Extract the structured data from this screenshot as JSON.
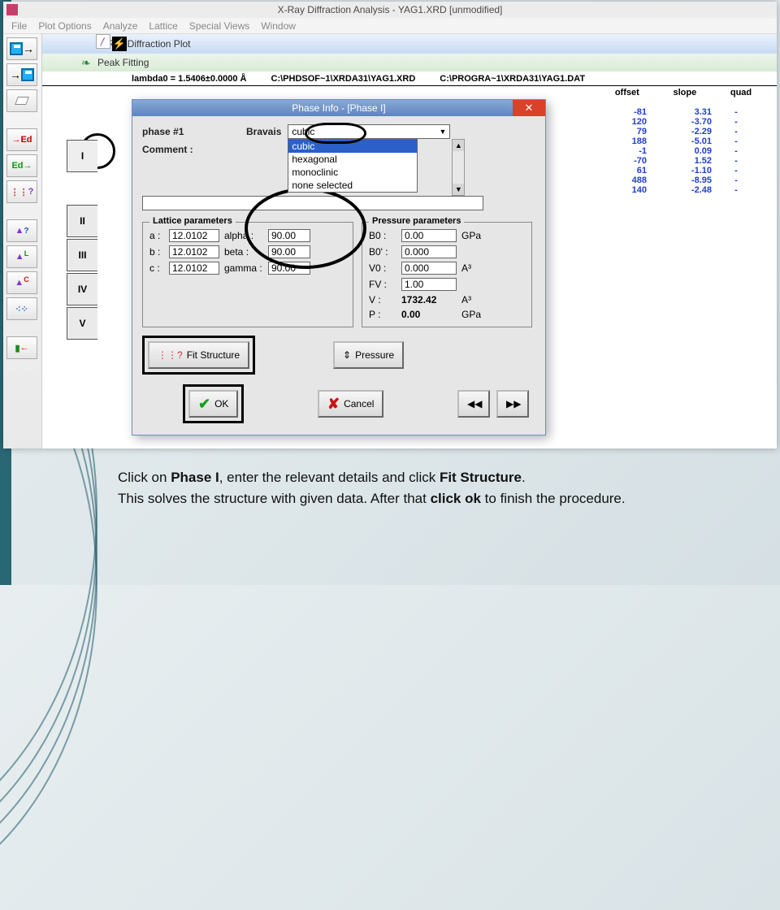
{
  "title": "X-Ray Diffraction Analysis - YAG1.XRD [unmodified]",
  "menu": [
    "File",
    "Plot Options",
    "Analyze",
    "Lattice",
    "Special Views",
    "Window"
  ],
  "toolbar": {
    "save_export": "→",
    "ed_red": "Ed",
    "ed_green": "Ed"
  },
  "bars": {
    "plot_title": "Ray Diffraction Plot",
    "fit_title": "Peak Fitting",
    "lambda": "lambda0 =  1.5406±0.0000 Å",
    "path1": "C:\\PHDSOF~1\\XRDA31\\YAG1.XRD",
    "path2": "C:\\PROGRA~1\\XRDA31\\YAG1.DAT"
  },
  "cols": {
    "c1": "offset",
    "c2": "slope",
    "c3": "quad"
  },
  "data": [
    {
      "o": "-81",
      "s": "3.31",
      "q": "-"
    },
    {
      "o": "120",
      "s": "-3.70",
      "q": "-"
    },
    {
      "o": "79",
      "s": "-2.29",
      "q": "-"
    },
    {
      "o": "188",
      "s": "-5.01",
      "q": "-"
    },
    {
      "o": "-1",
      "s": "0.09",
      "q": "-"
    },
    {
      "o": "-70",
      "s": "1.52",
      "q": "-"
    },
    {
      "o": "61",
      "s": "-1.10",
      "q": "-"
    },
    {
      "o": "488",
      "s": "-8.95",
      "q": "-"
    },
    {
      "o": "140",
      "s": "-2.48",
      "q": "-"
    }
  ],
  "tabs": [
    "I",
    "II",
    "III",
    "IV",
    "V"
  ],
  "dialog": {
    "title": "Phase Info - [Phase I]",
    "phase_label": "phase #1",
    "bravais_label": "Bravais",
    "bravais_value": "cubic",
    "options": [
      "cubic",
      "hexagonal",
      "monoclinic",
      "none selected"
    ],
    "comment_label": "Comment :",
    "lattice_legend": "Lattice parameters",
    "pressure_legend": "Pressure parameters",
    "a": "12.0102",
    "b": "12.0102",
    "c": "12.0102",
    "alpha": "90.00",
    "beta": "90.00",
    "gamma": "90.00",
    "a_l": "a :",
    "b_l": "b :",
    "c_l": "c :",
    "alpha_l": "alpha :",
    "beta_l": "beta :",
    "gamma_l": "gamma :",
    "B0_l": "B0 :",
    "B0": "0.00",
    "B0_u": "GPa",
    "B0p_l": "B0' :",
    "B0p": "0.000",
    "V0_l": "V0 :",
    "V0": "0.000",
    "V0_u": "A³",
    "FV_l": "FV :",
    "FV": "1.00",
    "V_l": "V :",
    "V": "1732.42",
    "V_u": "A³",
    "P_l": "P :",
    "P": "0.00",
    "P_u": "GPa",
    "fit_btn": "Fit Structure",
    "pressure_btn": "Pressure",
    "ok": "OK",
    "cancel": "Cancel"
  },
  "instr": {
    "l1a": "Click on ",
    "l1b": "Phase I",
    "l1c": ", enter the relevant details and click ",
    "l1d": "Fit Structure",
    "l1e": ".",
    "l2a": "This solves the structure with given data. After that ",
    "l2b": "click ok",
    "l2c": " to finish the procedure."
  }
}
